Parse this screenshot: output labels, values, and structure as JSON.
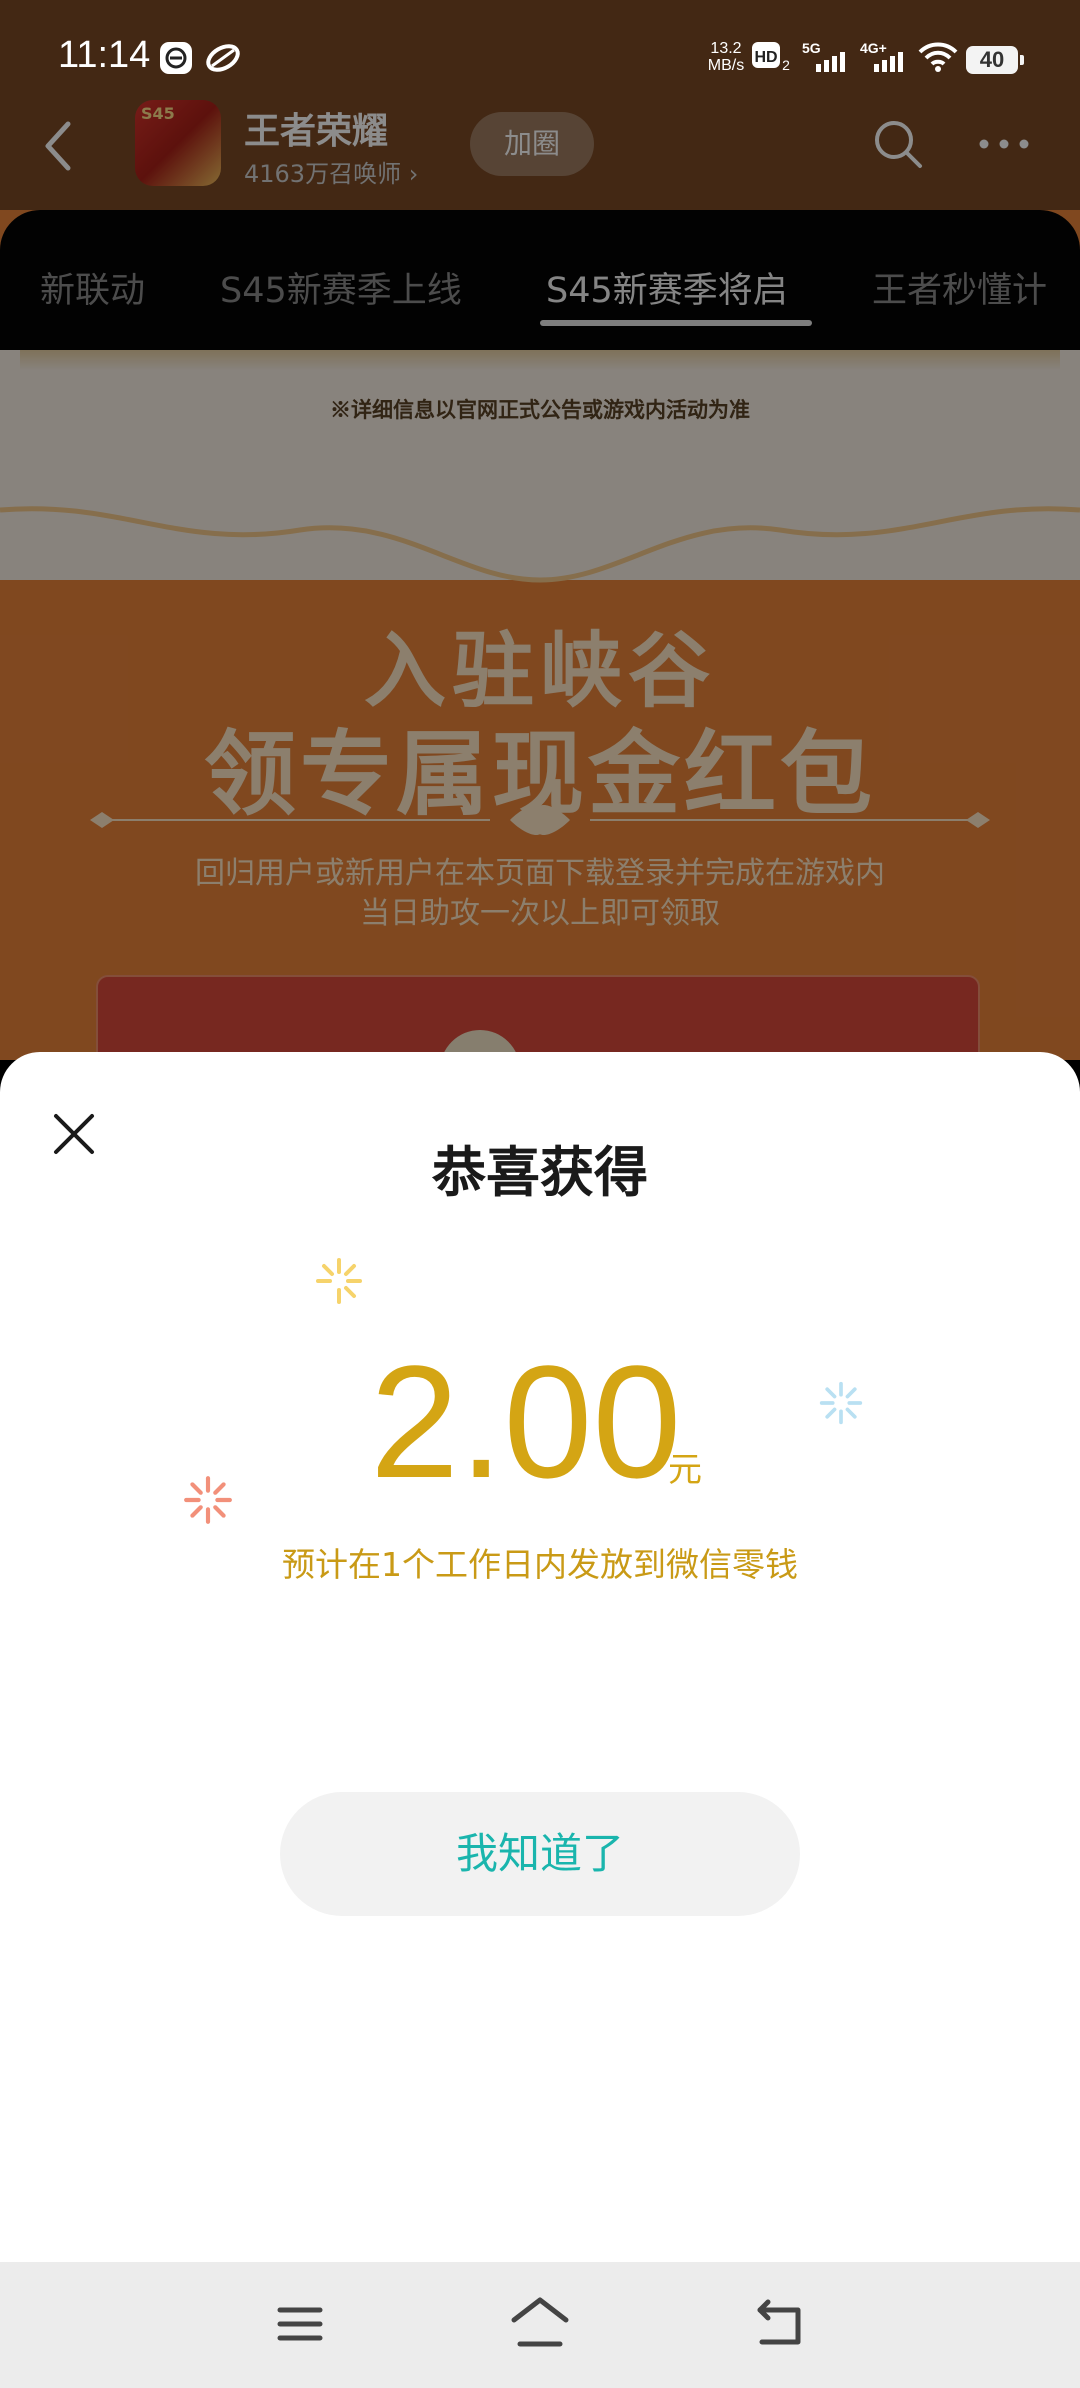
{
  "status_bar": {
    "time": "11:14",
    "net_speed_value": "13.2",
    "net_speed_unit": "MB/s",
    "battery": "40"
  },
  "circle_header": {
    "name": "王者荣耀",
    "members": "4163万召唤师 ›",
    "join_label": "加圈",
    "avatar_badge": "S45"
  },
  "tabs": [
    {
      "label": "新联动",
      "active": false
    },
    {
      "label": "S45新赛季上线",
      "active": false
    },
    {
      "label": "S45新赛季将启",
      "active": true
    },
    {
      "label": "王者秒懂计",
      "active": false
    }
  ],
  "banner": {
    "notice": "※详细信息以官网正式公告或游戏内活动为准",
    "title_line1": "入驻峡谷",
    "title_line2": "领专属现金红包",
    "desc_line1": "回归用户或新用户在本页面下载登录并完成在游戏内",
    "desc_line2": "当日助攻一次以上即可领取"
  },
  "reward_sheet": {
    "title": "恭喜获得",
    "amount": "2.00",
    "unit": "元",
    "hint": "预计在1个工作日内发放到微信零钱",
    "confirm_label": "我知道了"
  },
  "colors": {
    "amount_gold": "#D4A514",
    "button_text_teal": "#1AB5AD",
    "banner_orange": "#E9833A"
  }
}
